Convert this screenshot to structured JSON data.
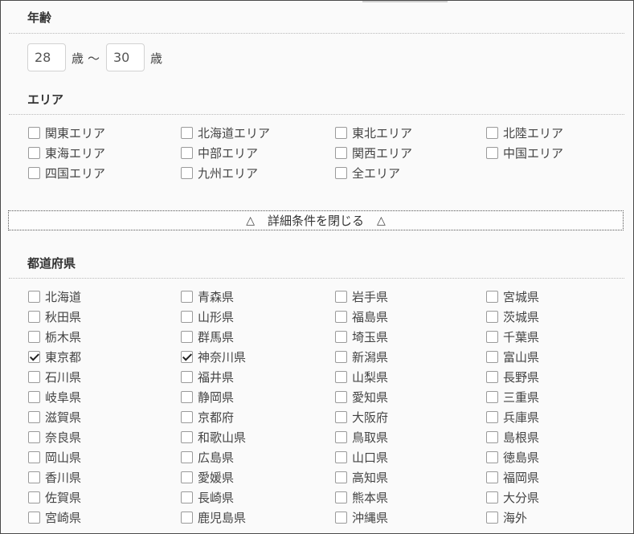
{
  "age": {
    "title": "年齢",
    "min_value": "28",
    "max_value": "30",
    "unit": "歳",
    "separator": "〜"
  },
  "area": {
    "title": "エリア",
    "items": [
      {
        "label": "関東エリア",
        "checked": false
      },
      {
        "label": "北海道エリア",
        "checked": false
      },
      {
        "label": "東北エリア",
        "checked": false
      },
      {
        "label": "北陸エリア",
        "checked": false
      },
      {
        "label": "東海エリア",
        "checked": false
      },
      {
        "label": "中部エリア",
        "checked": false
      },
      {
        "label": "関西エリア",
        "checked": false
      },
      {
        "label": "中国エリア",
        "checked": false
      },
      {
        "label": "四国エリア",
        "checked": false
      },
      {
        "label": "九州エリア",
        "checked": false
      },
      {
        "label": "全エリア",
        "checked": false
      }
    ]
  },
  "toggle": {
    "label": "詳細条件を閉じる",
    "left_icon": "△",
    "right_icon": "△"
  },
  "prefectures": {
    "title": "都道府県",
    "items": [
      {
        "label": "北海道",
        "checked": false
      },
      {
        "label": "青森県",
        "checked": false
      },
      {
        "label": "岩手県",
        "checked": false
      },
      {
        "label": "宮城県",
        "checked": false
      },
      {
        "label": "秋田県",
        "checked": false
      },
      {
        "label": "山形県",
        "checked": false
      },
      {
        "label": "福島県",
        "checked": false
      },
      {
        "label": "茨城県",
        "checked": false
      },
      {
        "label": "栃木県",
        "checked": false
      },
      {
        "label": "群馬県",
        "checked": false
      },
      {
        "label": "埼玉県",
        "checked": false
      },
      {
        "label": "千葉県",
        "checked": false
      },
      {
        "label": "東京都",
        "checked": true
      },
      {
        "label": "神奈川県",
        "checked": true
      },
      {
        "label": "新潟県",
        "checked": false
      },
      {
        "label": "富山県",
        "checked": false
      },
      {
        "label": "石川県",
        "checked": false
      },
      {
        "label": "福井県",
        "checked": false
      },
      {
        "label": "山梨県",
        "checked": false
      },
      {
        "label": "長野県",
        "checked": false
      },
      {
        "label": "岐阜県",
        "checked": false
      },
      {
        "label": "静岡県",
        "checked": false
      },
      {
        "label": "愛知県",
        "checked": false
      },
      {
        "label": "三重県",
        "checked": false
      },
      {
        "label": "滋賀県",
        "checked": false
      },
      {
        "label": "京都府",
        "checked": false
      },
      {
        "label": "大阪府",
        "checked": false
      },
      {
        "label": "兵庫県",
        "checked": false
      },
      {
        "label": "奈良県",
        "checked": false
      },
      {
        "label": "和歌山県",
        "checked": false
      },
      {
        "label": "鳥取県",
        "checked": false
      },
      {
        "label": "島根県",
        "checked": false
      },
      {
        "label": "岡山県",
        "checked": false
      },
      {
        "label": "広島県",
        "checked": false
      },
      {
        "label": "山口県",
        "checked": false
      },
      {
        "label": "徳島県",
        "checked": false
      },
      {
        "label": "香川県",
        "checked": false
      },
      {
        "label": "愛媛県",
        "checked": false
      },
      {
        "label": "高知県",
        "checked": false
      },
      {
        "label": "福岡県",
        "checked": false
      },
      {
        "label": "佐賀県",
        "checked": false
      },
      {
        "label": "長崎県",
        "checked": false
      },
      {
        "label": "熊本県",
        "checked": false
      },
      {
        "label": "大分県",
        "checked": false
      },
      {
        "label": "宮崎県",
        "checked": false
      },
      {
        "label": "鹿児島県",
        "checked": false
      },
      {
        "label": "沖縄県",
        "checked": false
      },
      {
        "label": "海外",
        "checked": false
      }
    ]
  }
}
